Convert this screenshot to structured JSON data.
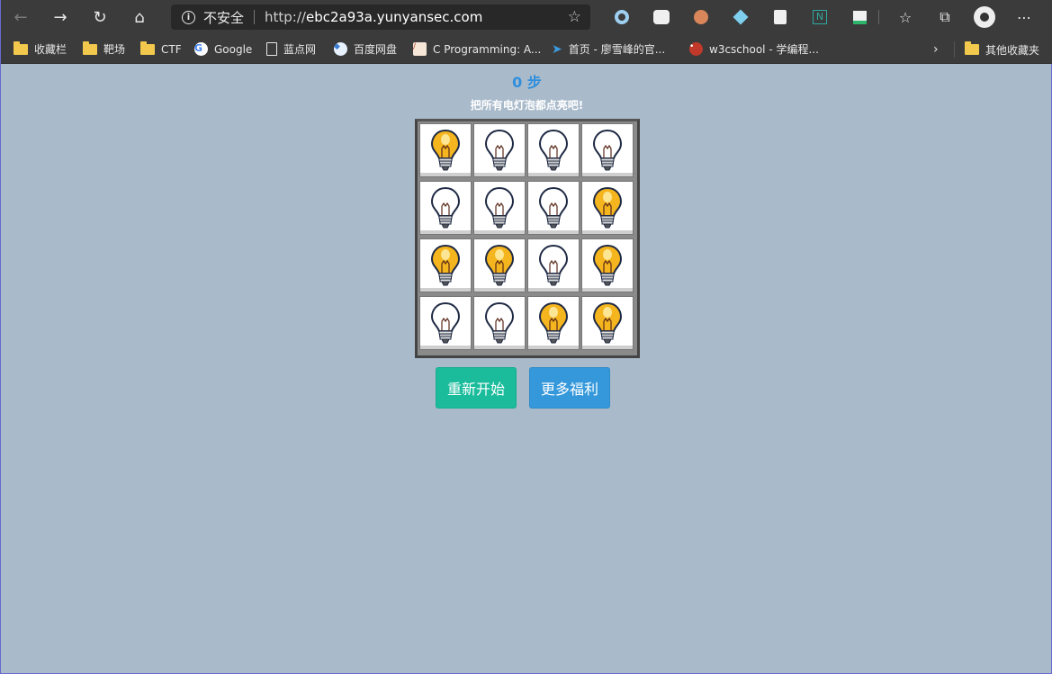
{
  "browser": {
    "insecure_label": "不安全",
    "url_prefix": "http://",
    "url_host": "ebc2a93a.yunyansec.com",
    "bookmarks": [
      {
        "label": "收藏栏",
        "icon": "folder-icon"
      },
      {
        "label": "靶场",
        "icon": "folder-icon"
      },
      {
        "label": "CTF",
        "icon": "folder-icon"
      },
      {
        "label": "Google",
        "icon": "google-icon"
      },
      {
        "label": "蓝点网",
        "icon": "page-icon"
      },
      {
        "label": "百度网盘",
        "icon": "baidu-pan-icon"
      },
      {
        "label": "C Programming: A...",
        "icon": "c-programming-icon"
      },
      {
        "label": "首页 - 廖雪峰的官...",
        "icon": "rocket-icon"
      },
      {
        "label": "w3cschool - 学编程...",
        "icon": "w3cschool-icon"
      }
    ],
    "other_bookmarks": "其他收藏夹"
  },
  "game": {
    "steps_label": "0 步",
    "hint": "把所有电灯泡都点亮吧!",
    "grid": [
      [
        1,
        0,
        0,
        0
      ],
      [
        0,
        0,
        0,
        1
      ],
      [
        1,
        1,
        0,
        1
      ],
      [
        0,
        0,
        1,
        1
      ]
    ],
    "restart_label": "重新开始",
    "more_label": "更多福利"
  },
  "colors": {
    "page_background": "#a9bacb",
    "steps_text": "#2f8fdc",
    "restart_button": "#1abc9c",
    "more_button": "#3498db",
    "bulb_on": "#f5b51e",
    "bulb_off": "#ffffff"
  }
}
